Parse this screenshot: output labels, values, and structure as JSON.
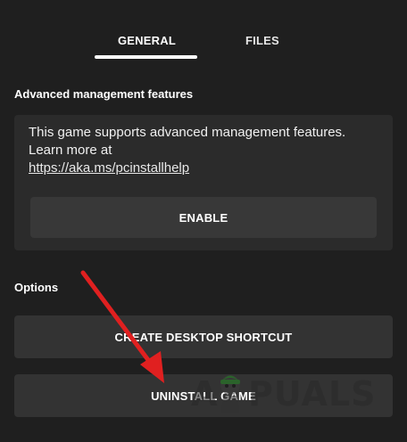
{
  "tabs": [
    {
      "label": "GENERAL",
      "active": true
    },
    {
      "label": "FILES",
      "active": false
    }
  ],
  "advanced": {
    "title": "Advanced management features",
    "description": "This game supports advanced management features. Learn more at",
    "link": "https://aka.ms/pcinstallhelp",
    "enable_label": "ENABLE"
  },
  "options": {
    "title": "Options",
    "create_shortcut_label": "CREATE DESKTOP SHORTCUT",
    "uninstall_label": "UNINSTALL GAME"
  },
  "watermark": {
    "left": "A",
    "right": "PUALS"
  },
  "colors": {
    "background": "#1f1f1f",
    "card": "#2b2b2b",
    "button": "#333333",
    "arrow": "#e02020",
    "text": "#ffffff"
  }
}
